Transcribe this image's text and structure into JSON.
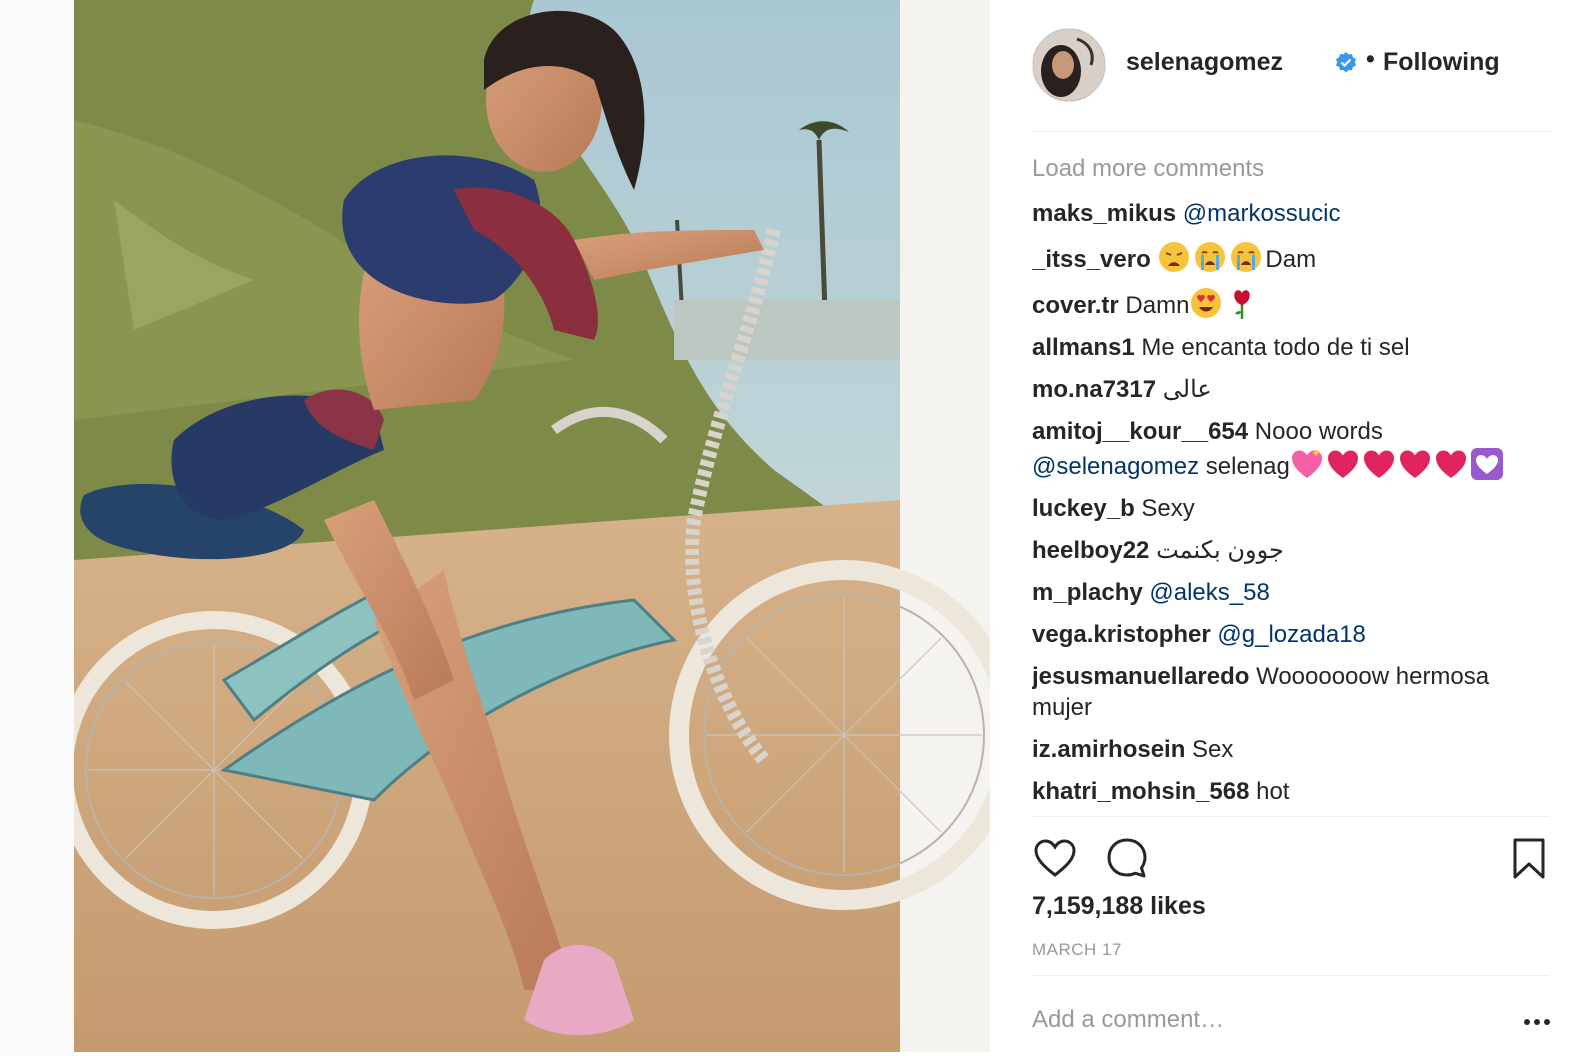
{
  "post": {
    "photo_alt": "",
    "author": {
      "username": "selenagomez",
      "verified": true,
      "follow_state": "Following",
      "separator": "•"
    },
    "load_more": "Load more comments",
    "comments": [
      {
        "user": "maks_mikus",
        "parts": [
          {
            "t": "mention",
            "v": "@markossucic"
          }
        ]
      },
      {
        "user": "_itss_vero",
        "parts": [
          {
            "t": "emoji",
            "v": "weary-face-emoji"
          },
          {
            "t": "emoji",
            "v": "crying-face-emoji"
          },
          {
            "t": "emoji",
            "v": "crying-face-emoji"
          },
          {
            "t": "text",
            "v": "Dam"
          }
        ]
      },
      {
        "user": "cover.tr",
        "parts": [
          {
            "t": "text",
            "v": "Damn"
          },
          {
            "t": "emoji",
            "v": "heart-eyes-emoji"
          },
          {
            "t": "emoji",
            "v": "rose-emoji"
          }
        ]
      },
      {
        "user": "allmans1",
        "parts": [
          {
            "t": "text",
            "v": "Me encanta todo de ti sel"
          }
        ]
      },
      {
        "user": "mo.na7317",
        "parts": [
          {
            "t": "text",
            "v": "عالی"
          }
        ]
      },
      {
        "user": "amitoj__kour__654",
        "parts": [
          {
            "t": "text",
            "v": "Nooo words "
          },
          {
            "t": "mention",
            "v": "@selenagomez"
          },
          {
            "t": "text",
            "v": " selenag"
          },
          {
            "t": "emoji",
            "v": "sparkling-heart-emoji"
          },
          {
            "t": "emoji",
            "v": "red-heart-emoji"
          },
          {
            "t": "emoji",
            "v": "red-heart-emoji"
          },
          {
            "t": "emoji",
            "v": "red-heart-emoji"
          },
          {
            "t": "emoji",
            "v": "red-heart-emoji"
          },
          {
            "t": "emoji",
            "v": "purple-heart-emoji"
          }
        ]
      },
      {
        "user": "luckey_b",
        "parts": [
          {
            "t": "text",
            "v": "Sexy"
          }
        ]
      },
      {
        "user": "heelboy22",
        "parts": [
          {
            "t": "text",
            "v": "جوون بكنمت"
          }
        ]
      },
      {
        "user": "m_plachy",
        "parts": [
          {
            "t": "mention",
            "v": "@aleks_58"
          }
        ]
      },
      {
        "user": "vega.kristopher",
        "parts": [
          {
            "t": "mention",
            "v": "@g_lozada18"
          }
        ]
      },
      {
        "user": "jesusmanuellaredo",
        "parts": [
          {
            "t": "text",
            "v": "Wooooooow hermosa mujer"
          }
        ]
      },
      {
        "user": "iz.amirhosein",
        "parts": [
          {
            "t": "text",
            "v": "Sex"
          }
        ]
      },
      {
        "user": "khatri_mohsin_568",
        "parts": [
          {
            "t": "text",
            "v": "hot"
          }
        ]
      }
    ],
    "actions": {
      "like_icon": "heart-icon",
      "comment_icon": "comment-bubble-icon",
      "save_icon": "bookmark-icon"
    },
    "likes": "7,159,188 likes",
    "date": "MARCH 17",
    "add_comment_placeholder": "Add a comment…",
    "more_icon": "more-options-icon",
    "colors": {
      "mention": "#003569",
      "verified": "#3897f0",
      "muted": "#999999",
      "text": "#262626"
    }
  }
}
